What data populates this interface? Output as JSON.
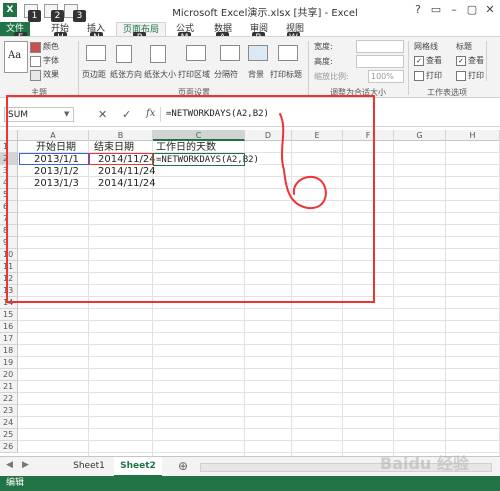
{
  "window": {
    "title": "Microsoft Excel演示.xlsx [共享] - Excel",
    "controls": [
      "?",
      "▭",
      "–",
      "▢",
      "✕"
    ],
    "keytips_qat": [
      "1",
      "2",
      "3"
    ]
  },
  "tabs": [
    {
      "label": "文件",
      "keytip": "F"
    },
    {
      "label": "开始",
      "keytip": "H"
    },
    {
      "label": "插入",
      "keytip": "N"
    },
    {
      "label": "页面布局",
      "keytip": "P"
    },
    {
      "label": "公式",
      "keytip": "M"
    },
    {
      "label": "数据",
      "keytip": "A"
    },
    {
      "label": "审阅",
      "keytip": "R"
    },
    {
      "label": "视图",
      "keytip": "W"
    }
  ],
  "ribbon": {
    "theme": {
      "label": "Aa",
      "items": [
        "颜色",
        "字体",
        "效果"
      ],
      "group": "主题"
    },
    "page_setup": {
      "items": [
        "页边距",
        "纸张方向",
        "纸张大小",
        "打印区域",
        "分隔符",
        "背景",
        "打印标题"
      ],
      "group": "页面设置"
    },
    "scale": {
      "width_label": "宽度:",
      "height_label": "高度:",
      "scale_label": "缩放比例:",
      "scale_value": "100%",
      "group": "调整为合适大小"
    },
    "sheet_options": {
      "gridlines": "网格线",
      "headings": "标题",
      "view": "查看",
      "print": "打印",
      "group": "工作表选项"
    }
  },
  "formula_bar": {
    "name_box": "SUM",
    "formula": "=NETWORKDAYS(A2,B2)",
    "fx": "fx"
  },
  "grid": {
    "columns": [
      "A",
      "B",
      "C",
      "D",
      "E",
      "F",
      "G",
      "H"
    ],
    "rows": [
      "1",
      "2",
      "3",
      "4",
      "5",
      "6",
      "7",
      "8",
      "9",
      "10",
      "11",
      "12",
      "13",
      "14",
      "15",
      "16",
      "17",
      "18",
      "19",
      "20",
      "21",
      "22",
      "23",
      "24",
      "25",
      "26"
    ],
    "cells": {
      "A1": "开始日期",
      "B1": "结束日期",
      "C1": "工作日的天数",
      "A2": "2013/1/1",
      "B2": "2014/11/24",
      "C2": "=NETWORKDAYS(A2,B2)",
      "A3": "2013/1/2",
      "B3": "2014/11/24",
      "A4": "2013/1/3",
      "B4": "2014/11/24"
    }
  },
  "sheets": {
    "nav": [
      "◀",
      "▶"
    ],
    "tabs": [
      "Sheet1",
      "Sheet2"
    ],
    "add": "⊕"
  },
  "status": {
    "mode": "编辑",
    "watermark": "Baidu 经验"
  }
}
